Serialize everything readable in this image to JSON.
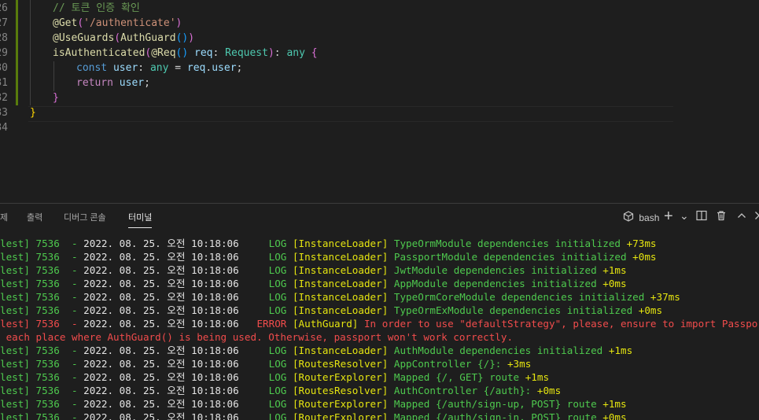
{
  "editor": {
    "lines": [
      {
        "num": "26",
        "indent": 1,
        "tokens": [
          {
            "t": "// 토큰 인증 확인",
            "c": "c-comment"
          }
        ]
      },
      {
        "num": "27",
        "indent": 1,
        "tokens": [
          {
            "t": "@Get",
            "c": "c-deco"
          },
          {
            "t": "(",
            "c": "c-paren1"
          },
          {
            "t": "'/authenticate'",
            "c": "c-str"
          },
          {
            "t": ")",
            "c": "c-paren1"
          }
        ]
      },
      {
        "num": "28",
        "indent": 1,
        "tokens": [
          {
            "t": "@UseGuards",
            "c": "c-deco"
          },
          {
            "t": "(",
            "c": "c-paren1"
          },
          {
            "t": "AuthGuard",
            "c": "c-fn"
          },
          {
            "t": "()",
            "c": "c-paren2"
          },
          {
            "t": ")",
            "c": "c-paren1"
          }
        ]
      },
      {
        "num": "29",
        "indent": 1,
        "tokens": [
          {
            "t": "isAuthenticated",
            "c": "c-fn"
          },
          {
            "t": "(",
            "c": "c-paren1"
          },
          {
            "t": "@Req",
            "c": "c-deco"
          },
          {
            "t": "()",
            "c": "c-paren2"
          },
          {
            "t": " req",
            "c": "c-var"
          },
          {
            "t": ": ",
            "c": "c-plain"
          },
          {
            "t": "Request",
            "c": "c-type"
          },
          {
            "t": ")",
            "c": "c-paren1"
          },
          {
            "t": ": ",
            "c": "c-plain"
          },
          {
            "t": "any",
            "c": "c-type"
          },
          {
            "t": " ",
            "c": "c-plain"
          },
          {
            "t": "{",
            "c": "c-paren1"
          }
        ]
      },
      {
        "num": "30",
        "indent": 2,
        "tokens": [
          {
            "t": "const",
            "c": "c-kw"
          },
          {
            "t": " user",
            "c": "c-var"
          },
          {
            "t": ": ",
            "c": "c-plain"
          },
          {
            "t": "any",
            "c": "c-type"
          },
          {
            "t": " = ",
            "c": "c-plain"
          },
          {
            "t": "req",
            "c": "c-var"
          },
          {
            "t": ".",
            "c": "c-plain"
          },
          {
            "t": "user",
            "c": "c-var"
          },
          {
            "t": ";",
            "c": "c-plain"
          }
        ]
      },
      {
        "num": "31",
        "indent": 2,
        "tokens": [
          {
            "t": "return",
            "c": "c-ctl"
          },
          {
            "t": " user",
            "c": "c-var"
          },
          {
            "t": ";",
            "c": "c-plain"
          }
        ]
      },
      {
        "num": "32",
        "indent": 1,
        "tokens": [
          {
            "t": "}",
            "c": "c-paren1"
          }
        ]
      },
      {
        "num": "33",
        "indent": 0,
        "tokens": [
          {
            "t": "}",
            "c": "c-gold"
          }
        ]
      },
      {
        "num": "34",
        "indent": 0,
        "tokens": []
      }
    ]
  },
  "panel": {
    "tabs": [
      {
        "label": "제"
      },
      {
        "label": "출력"
      },
      {
        "label": "디버그 콘솔"
      },
      {
        "label": "터미널",
        "active": true
      }
    ],
    "toolbar": {
      "shell_label": "bash",
      "add_label": "+",
      "dropdown_label": "⌄",
      "split_label": "◫",
      "trash_label": "🗑",
      "maximize_label": "∧",
      "close_label": "×"
    }
  },
  "terminal": {
    "lines": [
      {
        "prefix": "lest] 7536  - ",
        "date": "2022. 08. 25. 오전 10:18:06",
        "level": "     LOG",
        "ctx": "[InstanceLoader]",
        "msg": " TypeOrmModule dependencies initialized",
        "time": " +73ms",
        "kind": "log"
      },
      {
        "prefix": "lest] 7536  - ",
        "date": "2022. 08. 25. 오전 10:18:06",
        "level": "     LOG",
        "ctx": "[InstanceLoader]",
        "msg": " PassportModule dependencies initialized",
        "time": " +0ms",
        "kind": "log"
      },
      {
        "prefix": "lest] 7536  - ",
        "date": "2022. 08. 25. 오전 10:18:06",
        "level": "     LOG",
        "ctx": "[InstanceLoader]",
        "msg": " JwtModule dependencies initialized",
        "time": " +1ms",
        "kind": "log"
      },
      {
        "prefix": "lest] 7536  - ",
        "date": "2022. 08. 25. 오전 10:18:06",
        "level": "     LOG",
        "ctx": "[InstanceLoader]",
        "msg": " AppModule dependencies initialized",
        "time": " +0ms",
        "kind": "log"
      },
      {
        "prefix": "lest] 7536  - ",
        "date": "2022. 08. 25. 오전 10:18:06",
        "level": "     LOG",
        "ctx": "[InstanceLoader]",
        "msg": " TypeOrmCoreModule dependencies initialized",
        "time": " +37ms",
        "kind": "log"
      },
      {
        "prefix": "lest] 7536  - ",
        "date": "2022. 08. 25. 오전 10:18:06",
        "level": "     LOG",
        "ctx": "[InstanceLoader]",
        "msg": " TypeOrmExModule dependencies initialized",
        "time": " +0ms",
        "kind": "log"
      },
      {
        "prefix": "lest] 7536  - ",
        "date": "2022. 08. 25. 오전 10:18:06",
        "level": "   ERROR",
        "ctx": "[AuthGuard]",
        "msg": " In order to use \"defaultStrategy\", please, ensure to import PassportModule i",
        "time": "",
        "kind": "error"
      },
      {
        "prefix": "",
        "date": "",
        "level": "",
        "ctx": "",
        "msg": " each place where AuthGuard() is being used. Otherwise, passport won't work correctly.",
        "time": "",
        "kind": "error-cont"
      },
      {
        "prefix": "lest] 7536  - ",
        "date": "2022. 08. 25. 오전 10:18:06",
        "level": "     LOG",
        "ctx": "[InstanceLoader]",
        "msg": " AuthModule dependencies initialized",
        "time": " +1ms",
        "kind": "log"
      },
      {
        "prefix": "lest] 7536  - ",
        "date": "2022. 08. 25. 오전 10:18:06",
        "level": "     LOG",
        "ctx": "[RoutesResolver]",
        "msg": " AppController {/}:",
        "time": " +3ms",
        "kind": "log"
      },
      {
        "prefix": "lest] 7536  - ",
        "date": "2022. 08. 25. 오전 10:18:06",
        "level": "     LOG",
        "ctx": "[RouterExplorer]",
        "msg": " Mapped {/, GET} route",
        "time": " +1ms",
        "kind": "log"
      },
      {
        "prefix": "lest] 7536  - ",
        "date": "2022. 08. 25. 오전 10:18:06",
        "level": "     LOG",
        "ctx": "[RoutesResolver]",
        "msg": " AuthController {/auth}:",
        "time": " +0ms",
        "kind": "log"
      },
      {
        "prefix": "lest] 7536  - ",
        "date": "2022. 08. 25. 오전 10:18:06",
        "level": "     LOG",
        "ctx": "[RouterExplorer]",
        "msg": " Mapped {/auth/sign-up, POST} route",
        "time": " +1ms",
        "kind": "log"
      },
      {
        "prefix": "lest] 7536  - ",
        "date": "2022. 08. 25. 오전 10:18:06",
        "level": "     LOG",
        "ctx": "[RouterExplorer]",
        "msg": " Mapped {/auth/sign-in, POST} route",
        "time": " +0ms",
        "kind": "log"
      }
    ]
  }
}
